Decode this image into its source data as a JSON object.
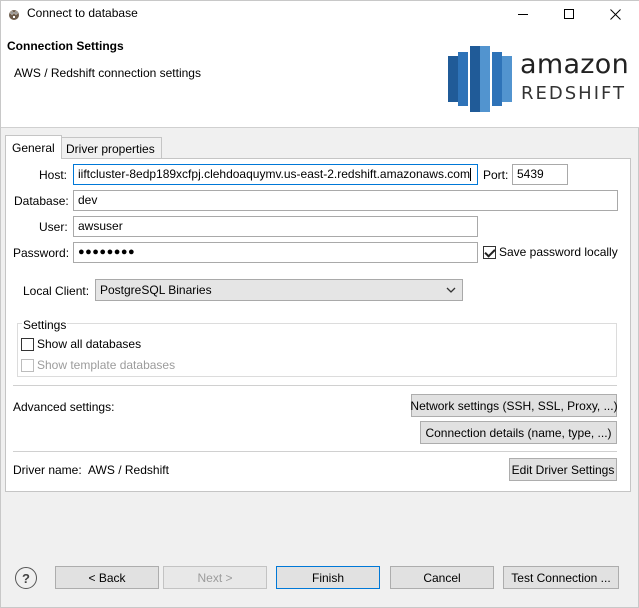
{
  "window": {
    "title": "Connect to database"
  },
  "header": {
    "title": "Connection Settings",
    "subtitle": "AWS / Redshift connection settings",
    "logo_word1": "amazon",
    "logo_word2": "REDSHIFT"
  },
  "tabs": [
    {
      "label": "General",
      "active": true
    },
    {
      "label": "Driver properties",
      "active": false
    }
  ],
  "form": {
    "host_label": "Host:",
    "host_value": "iiftcluster-8edp189xcfpj.clehdoaquymv.us-east-2.redshift.amazonaws.com",
    "port_label": "Port:",
    "port_value": "5439",
    "database_label": "Database:",
    "database_value": "dev",
    "user_label": "User:",
    "user_value": "awsuser",
    "password_label": "Password:",
    "password_value": "●●●●●●●●",
    "save_password_label": "Save password locally",
    "save_password_checked": true,
    "local_client_label": "Local Client:",
    "local_client_value": "PostgreSQL Binaries"
  },
  "settings_group": {
    "label": "Settings",
    "show_all_databases": "Show all databases",
    "show_template_databases": "Show template databases"
  },
  "advanced": {
    "label": "Advanced settings:",
    "network_button": "Network settings (SSH, SSL, Proxy, ...)",
    "connection_details_button": "Connection details (name, type, ...)"
  },
  "driver": {
    "label": "Driver name:",
    "value": "AWS / Redshift",
    "edit_button": "Edit Driver Settings"
  },
  "footer": {
    "help_symbol": "?",
    "back": "< Back",
    "next": "Next >",
    "finish": "Finish",
    "cancel": "Cancel",
    "test": "Test Connection ..."
  },
  "colors": {
    "focus_border": "#0078d7",
    "logo_blue_dark": "#205b98",
    "logo_blue_mid": "#2e73b8",
    "logo_blue_light": "#5294cf"
  },
  "icons": {
    "app": "dbeaver-beaver-icon",
    "minimize": "minimize-icon",
    "maximize": "maximize-icon",
    "close": "close-icon",
    "dropdown": "chevron-down-icon",
    "help": "help-icon",
    "logo": "redshift-logo-icon"
  }
}
